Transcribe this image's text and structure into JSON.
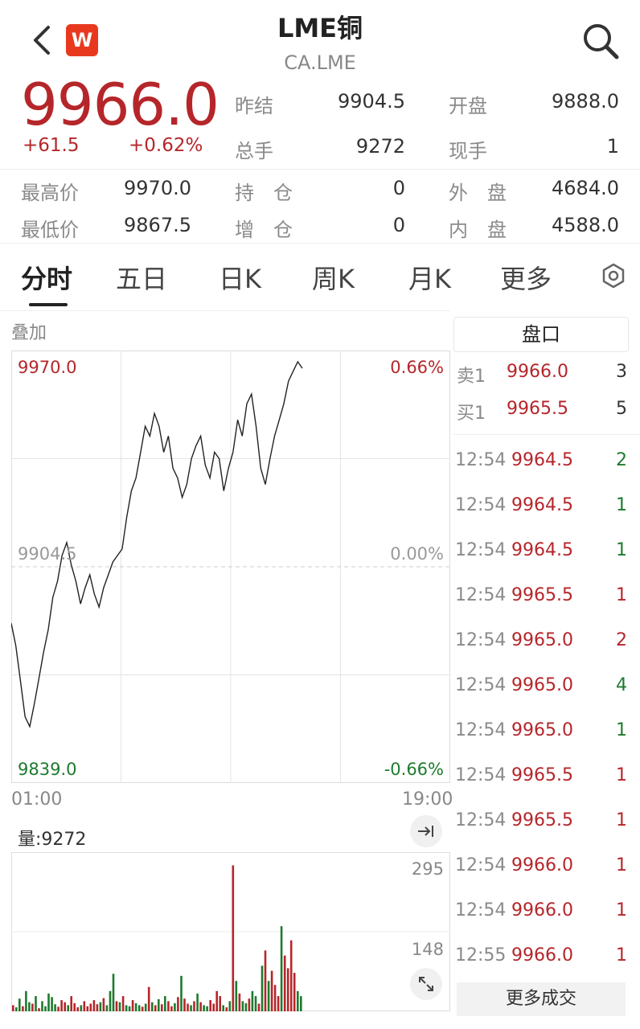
{
  "header": {
    "title": "LME铜",
    "subtitle": "CA.LME",
    "logo_text": "W",
    "logo_color": "#e8391f"
  },
  "quote": {
    "price": "9966.0",
    "change": "+61.5",
    "change_pct": "+0.62%",
    "stats": [
      {
        "label": "昨结",
        "value": "9904.5"
      },
      {
        "label": "开盘",
        "value": "9888.0"
      },
      {
        "label": "总手",
        "value": "9272"
      },
      {
        "label": "现手",
        "value": "1"
      },
      {
        "label": "最高价",
        "value": "9970.0"
      },
      {
        "label": "持　仓",
        "value": "0"
      },
      {
        "label": "外　盘",
        "value": "4684.0"
      },
      {
        "label": "最低价",
        "value": "9867.5"
      },
      {
        "label": "增　仓",
        "value": "0"
      },
      {
        "label": "内　盘",
        "value": "4588.0"
      }
    ]
  },
  "tabs": [
    "分时",
    "五日",
    "日K",
    "周K",
    "月K",
    "更多"
  ],
  "chart": {
    "overlay_label": "叠加",
    "y_high": "9970.0",
    "y_mid": "9904.5",
    "y_low": "9839.0",
    "pct_high": "0.66%",
    "pct_mid": "0.00%",
    "pct_low": "-0.66%",
    "time_start": "01:00",
    "time_end": "19:00",
    "volume_label": "量:9272",
    "vol_high": "295",
    "vol_mid": "148"
  },
  "chart_data": {
    "type": "line",
    "ylim": [
      9839.0,
      9970.0
    ],
    "reference": 9904.5,
    "x_range": [
      "01:00",
      "19:00"
    ],
    "series": [
      {
        "values": [
          9887,
          9880,
          9869,
          9858,
          9855,
          9862,
          9870,
          9878,
          9885,
          9895,
          9900,
          9908,
          9912,
          9905,
          9900,
          9893,
          9898,
          9902,
          9896,
          9892,
          9898,
          9902,
          9906,
          9908,
          9910,
          9920,
          9928,
          9932,
          9940,
          9948,
          9945,
          9952,
          9948,
          9940,
          9945,
          9935,
          9932,
          9926,
          9930,
          9938,
          9942,
          9945,
          9936,
          9932,
          9940,
          9938,
          9928,
          9935,
          9940,
          9950,
          9945,
          9955,
          9958,
          9948,
          9935,
          9930,
          9938,
          9945,
          9950,
          9955,
          9962,
          9965,
          9968,
          9966
        ]
      }
    ],
    "volume": {
      "ylim": [
        0,
        295
      ],
      "values": [
        12,
        8,
        25,
        10,
        40,
        18,
        15,
        30,
        6,
        20,
        10,
        35,
        28,
        14,
        9,
        22,
        18,
        12,
        30,
        16,
        8,
        12,
        20,
        10,
        15,
        22,
        14,
        18,
        26,
        12,
        40,
        74,
        20,
        18,
        30,
        12,
        10,
        22,
        16,
        12,
        9,
        15,
        48,
        18,
        12,
        24,
        14,
        30,
        20,
        10,
        16,
        28,
        70,
        25,
        15,
        12,
        20,
        35,
        18,
        12,
        10,
        22,
        15,
        40,
        30,
        12,
        8,
        20,
        288,
        60,
        35,
        20,
        16,
        25,
        40,
        30,
        15,
        90,
        120,
        60,
        80,
        52,
        30,
        168,
        110,
        85,
        140,
        76,
        40,
        30
      ]
    },
    "colors": {
      "up": "#b5262a",
      "down": "#1e7a2e",
      "line": "#222222"
    }
  },
  "panel": {
    "title": "盘口",
    "book": [
      {
        "side": "卖1",
        "price": "9966.0",
        "qty": "3"
      },
      {
        "side": "买1",
        "price": "9965.5",
        "qty": "5"
      }
    ],
    "trades": [
      {
        "time": "12:54",
        "price": "9964.5",
        "qty": "2",
        "dir": "down"
      },
      {
        "time": "12:54",
        "price": "9964.5",
        "qty": "1",
        "dir": "down"
      },
      {
        "time": "12:54",
        "price": "9964.5",
        "qty": "1",
        "dir": "down"
      },
      {
        "time": "12:54",
        "price": "9965.5",
        "qty": "1",
        "dir": "up"
      },
      {
        "time": "12:54",
        "price": "9965.0",
        "qty": "2",
        "dir": "up"
      },
      {
        "time": "12:54",
        "price": "9965.0",
        "qty": "4",
        "dir": "down"
      },
      {
        "time": "12:54",
        "price": "9965.0",
        "qty": "1",
        "dir": "down"
      },
      {
        "time": "12:54",
        "price": "9965.5",
        "qty": "1",
        "dir": "up"
      },
      {
        "time": "12:54",
        "price": "9965.5",
        "qty": "1",
        "dir": "up"
      },
      {
        "time": "12:54",
        "price": "9966.0",
        "qty": "1",
        "dir": "up"
      },
      {
        "time": "12:54",
        "price": "9966.0",
        "qty": "1",
        "dir": "up"
      },
      {
        "time": "12:55",
        "price": "9966.0",
        "qty": "1",
        "dir": "up"
      }
    ],
    "more_label": "更多成交"
  },
  "icons": [
    "back-icon",
    "search-icon",
    "settings-icon",
    "expand-right-icon",
    "fullscreen-icon"
  ]
}
